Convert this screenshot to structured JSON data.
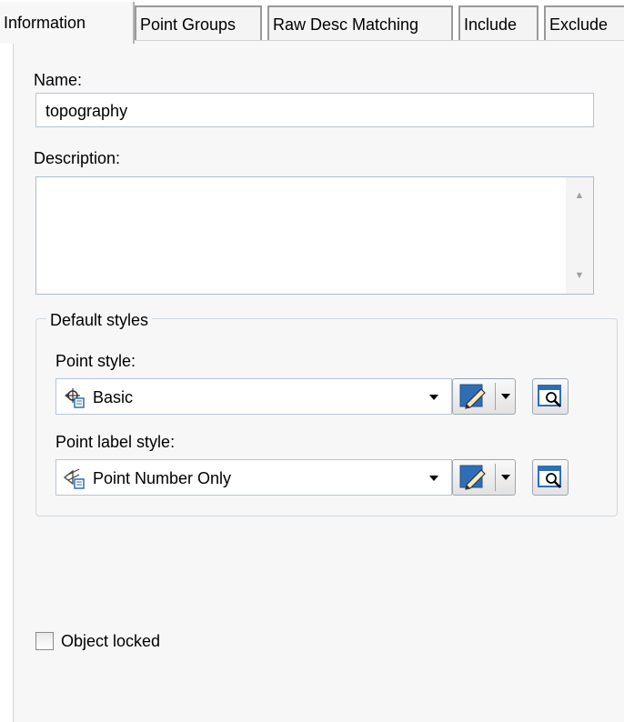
{
  "tabs": [
    {
      "label": "Information",
      "active": true
    },
    {
      "label": "Point Groups",
      "active": false
    },
    {
      "label": "Raw Desc Matching",
      "active": false
    },
    {
      "label": "Include",
      "active": false
    },
    {
      "label": "Exclude",
      "active": false
    }
  ],
  "info": {
    "name_label": "Name:",
    "name_value": "topography",
    "description_label": "Description:",
    "description_value": ""
  },
  "default_styles": {
    "caption": "Default styles",
    "point_style_label": "Point style:",
    "point_style_value": "Basic",
    "point_label_style_label": "Point label style:",
    "point_label_style_value": "Point Number Only"
  },
  "object_locked": {
    "label": "Object locked",
    "checked": false
  },
  "colors": {
    "accent_blue": "#2f6db5",
    "border_blue": "#a9bcd2"
  }
}
